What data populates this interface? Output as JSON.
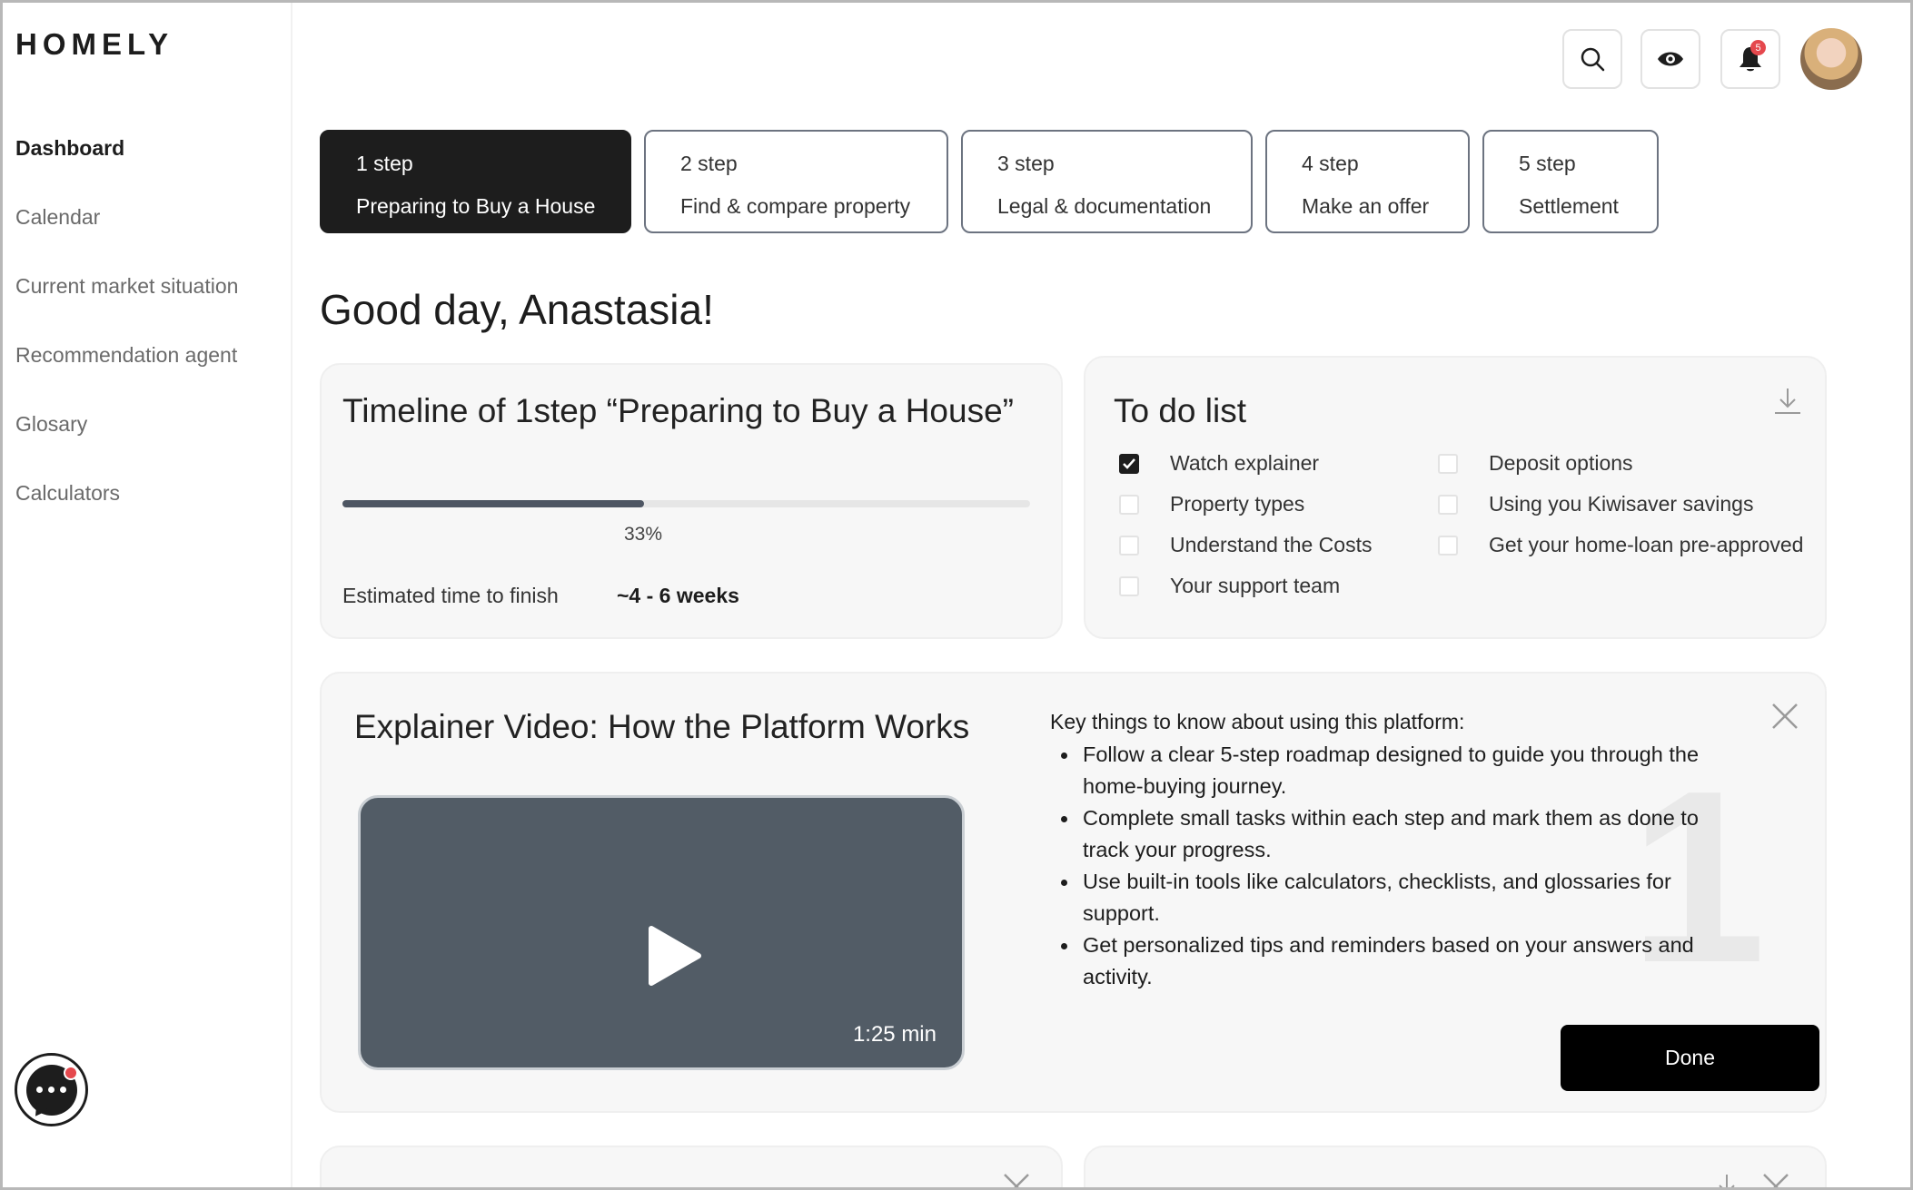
{
  "app": {
    "logo": "HOMELY"
  },
  "sidebar": {
    "items": [
      {
        "label": "Dashboard",
        "active": true
      },
      {
        "label": "Calendar"
      },
      {
        "label": "Current market situation"
      },
      {
        "label": "Recommendation agent"
      },
      {
        "label": "Glosary"
      },
      {
        "label": "Calculators"
      }
    ]
  },
  "header": {
    "notifications_count": "5",
    "icons": [
      "search-icon",
      "eye-icon",
      "bell-icon",
      "avatar"
    ]
  },
  "steps": [
    {
      "num": "1 step",
      "label": "Preparing to Buy a House",
      "active": true
    },
    {
      "num": "2 step",
      "label": "Find & compare property"
    },
    {
      "num": "3 step",
      "label": "Legal & documentation"
    },
    {
      "num": "4 step",
      "label": "Make an offer"
    },
    {
      "num": "5 step",
      "label": "Settlement"
    }
  ],
  "greeting": "Good day, Anastasia!",
  "timeline": {
    "title": "Timeline of 1step “Preparing to Buy a House”",
    "progress_percent": 33,
    "progress_label": "33%",
    "estimated_label": "Estimated time to finish",
    "estimated_value": "~4 - 6 weeks"
  },
  "todo": {
    "title": "To do list",
    "items": [
      {
        "label": "Watch explainer",
        "checked": true
      },
      {
        "label": "Property types",
        "checked": false
      },
      {
        "label": "Understand the Costs",
        "checked": false
      },
      {
        "label": "Your support team",
        "checked": false
      },
      {
        "label": "Deposit options",
        "checked": false
      },
      {
        "label": "Using you Kiwisaver savings",
        "checked": false
      },
      {
        "label": "Get your home-loan pre-approved",
        "checked": false
      }
    ]
  },
  "explainer": {
    "title": "Explainer Video: How the Platform Works",
    "duration": "1:25 min",
    "watermark_number": "1",
    "key_title": "Key things to know about using this platform:",
    "points": [
      "Follow a clear 5-step roadmap designed to guide you through the home-buying journey.",
      "Complete small tasks within each step and mark them as done to track your progress.",
      "Use built-in tools like calculators, checklists, and glossaries for support.",
      "Get personalized tips and reminders based on your answers and activity."
    ],
    "done_label": "Done"
  },
  "colors": {
    "accent_dark": "#1d1d1d",
    "badge_red": "#e5484d",
    "video_bg": "#525c66",
    "progress_fill": "#4e5663"
  }
}
